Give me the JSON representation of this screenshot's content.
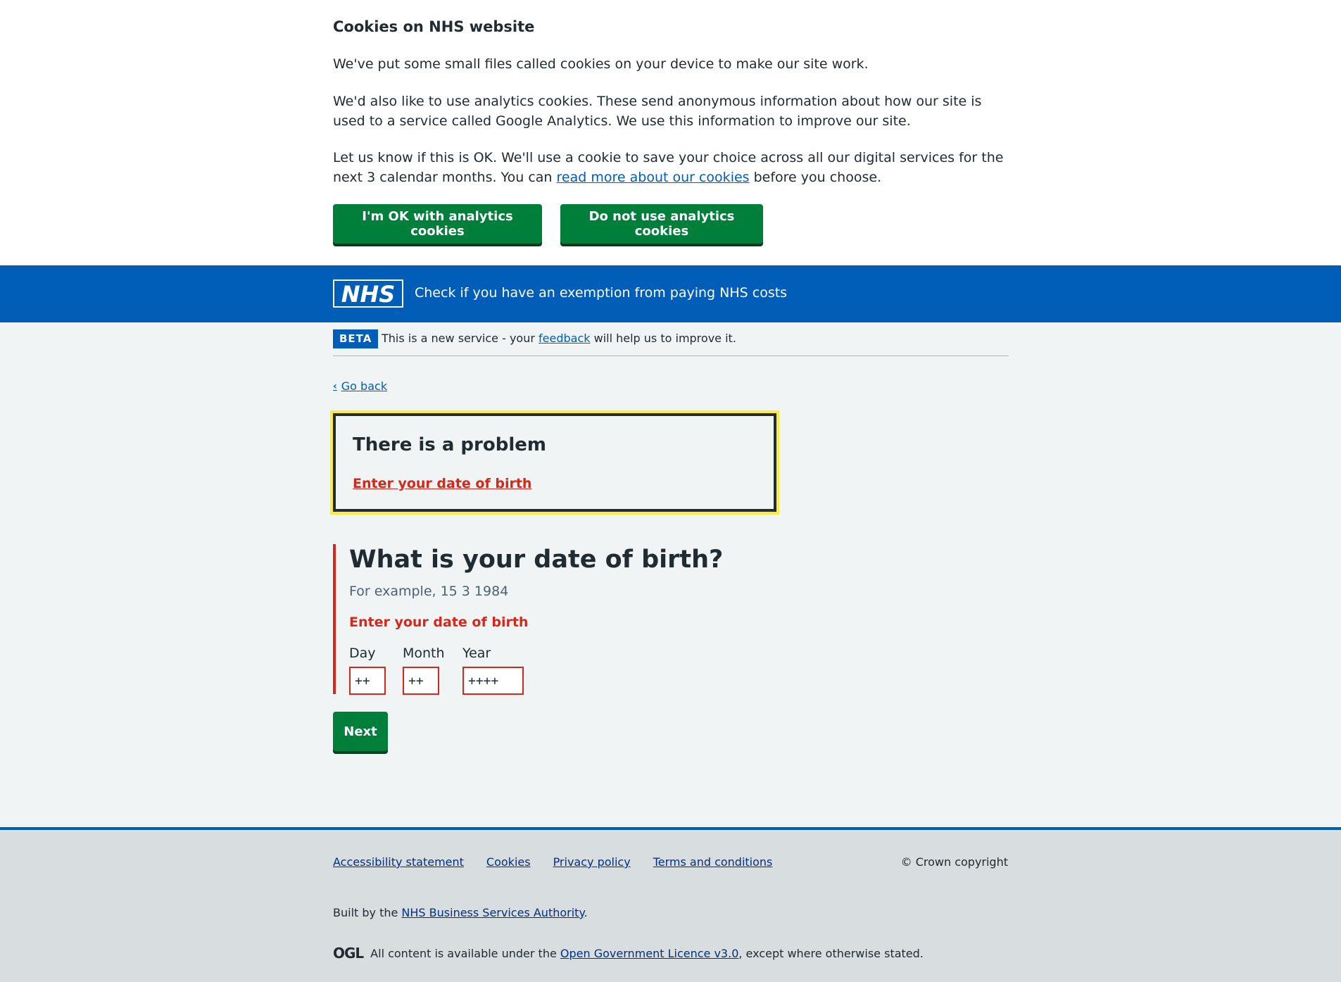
{
  "cookie_banner": {
    "title": "Cookies on NHS website",
    "p1": "We've put some small files called cookies on your device to make our site work.",
    "p2": "We'd also like to use analytics cookies. These send anonymous information about how our site is used to a service called Google Analytics. We use this information to improve our site.",
    "p3_before": "Let us know if this is OK. We'll use a cookie to save your choice across all our digital services for the next 3 calendar months. You can ",
    "p3_link": "read more about our cookies",
    "p3_after": " before you choose.",
    "accept_label": "I'm OK with analytics cookies",
    "reject_label": "Do not use analytics cookies"
  },
  "header": {
    "logo_text": "NHS",
    "service_name": "Check if you have an exemption from paying NHS costs"
  },
  "beta": {
    "tag": "BETA",
    "text_before": "This is a new service - your ",
    "link": "feedback",
    "text_after": " will help us to improve it."
  },
  "back_link": "Go back",
  "error_summary": {
    "title": "There is a problem",
    "link": "Enter your date of birth"
  },
  "question": {
    "title": "What is your date of birth?",
    "hint": "For example, 15 3 1984",
    "error": "Enter your date of birth",
    "day_label": "Day",
    "day_value": "++",
    "month_label": "Month",
    "month_value": "++",
    "year_label": "Year",
    "year_value": "++++"
  },
  "next_label": "Next",
  "footer": {
    "links": [
      "Accessibility statement",
      "Cookies",
      "Privacy policy",
      "Terms and conditions"
    ],
    "copyright": "© Crown copyright",
    "built_before": "Built by the ",
    "built_link": "NHS Business Services Authority",
    "built_after": ".",
    "ogl_icon": "OGL",
    "ogl_before": "All content is available under the ",
    "ogl_link": "Open Government Licence v3.0",
    "ogl_after": ", except where otherwise stated."
  },
  "colors": {
    "nhs_blue": "#005eb8",
    "green": "#007f3b",
    "error_red": "#d5281b",
    "focus_yellow": "#ffeb3b"
  }
}
